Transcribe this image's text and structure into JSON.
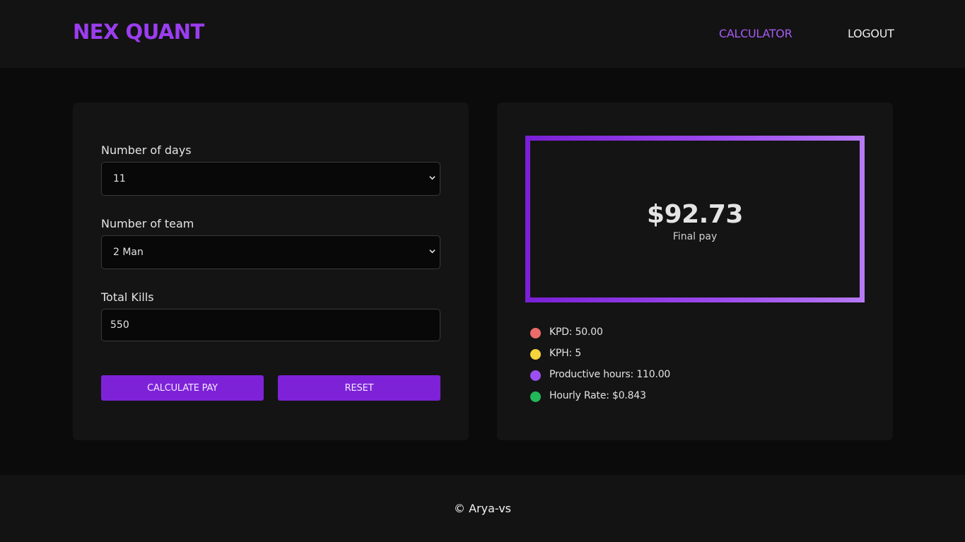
{
  "header": {
    "brand": "NEX QUANT",
    "nav": {
      "calculator": "CALCULATOR",
      "logout": "LOGOUT"
    }
  },
  "form": {
    "days": {
      "label": "Number of days",
      "value": "11"
    },
    "team": {
      "label": "Number of team",
      "value": "2 Man"
    },
    "kills": {
      "label": "Total Kills",
      "value": "550"
    },
    "buttons": {
      "calculate": "CALCULATE PAY",
      "reset": "RESET"
    }
  },
  "result": {
    "amount": "$92.73",
    "label": "Final pay",
    "stats": [
      {
        "text": "KPD: 50.00",
        "color": "#ef6b6b"
      },
      {
        "text": "KPH: 5",
        "color": "#f5d43c"
      },
      {
        "text": "Productive hours: 110.00",
        "color": "#9b4ff0"
      },
      {
        "text": "Hourly Rate: $0.843",
        "color": "#22b85a"
      }
    ]
  },
  "colors": {
    "accent": "#7e22d8",
    "brand": "#9b3df0"
  },
  "footer": {
    "copyright": "© Arya-vs"
  }
}
